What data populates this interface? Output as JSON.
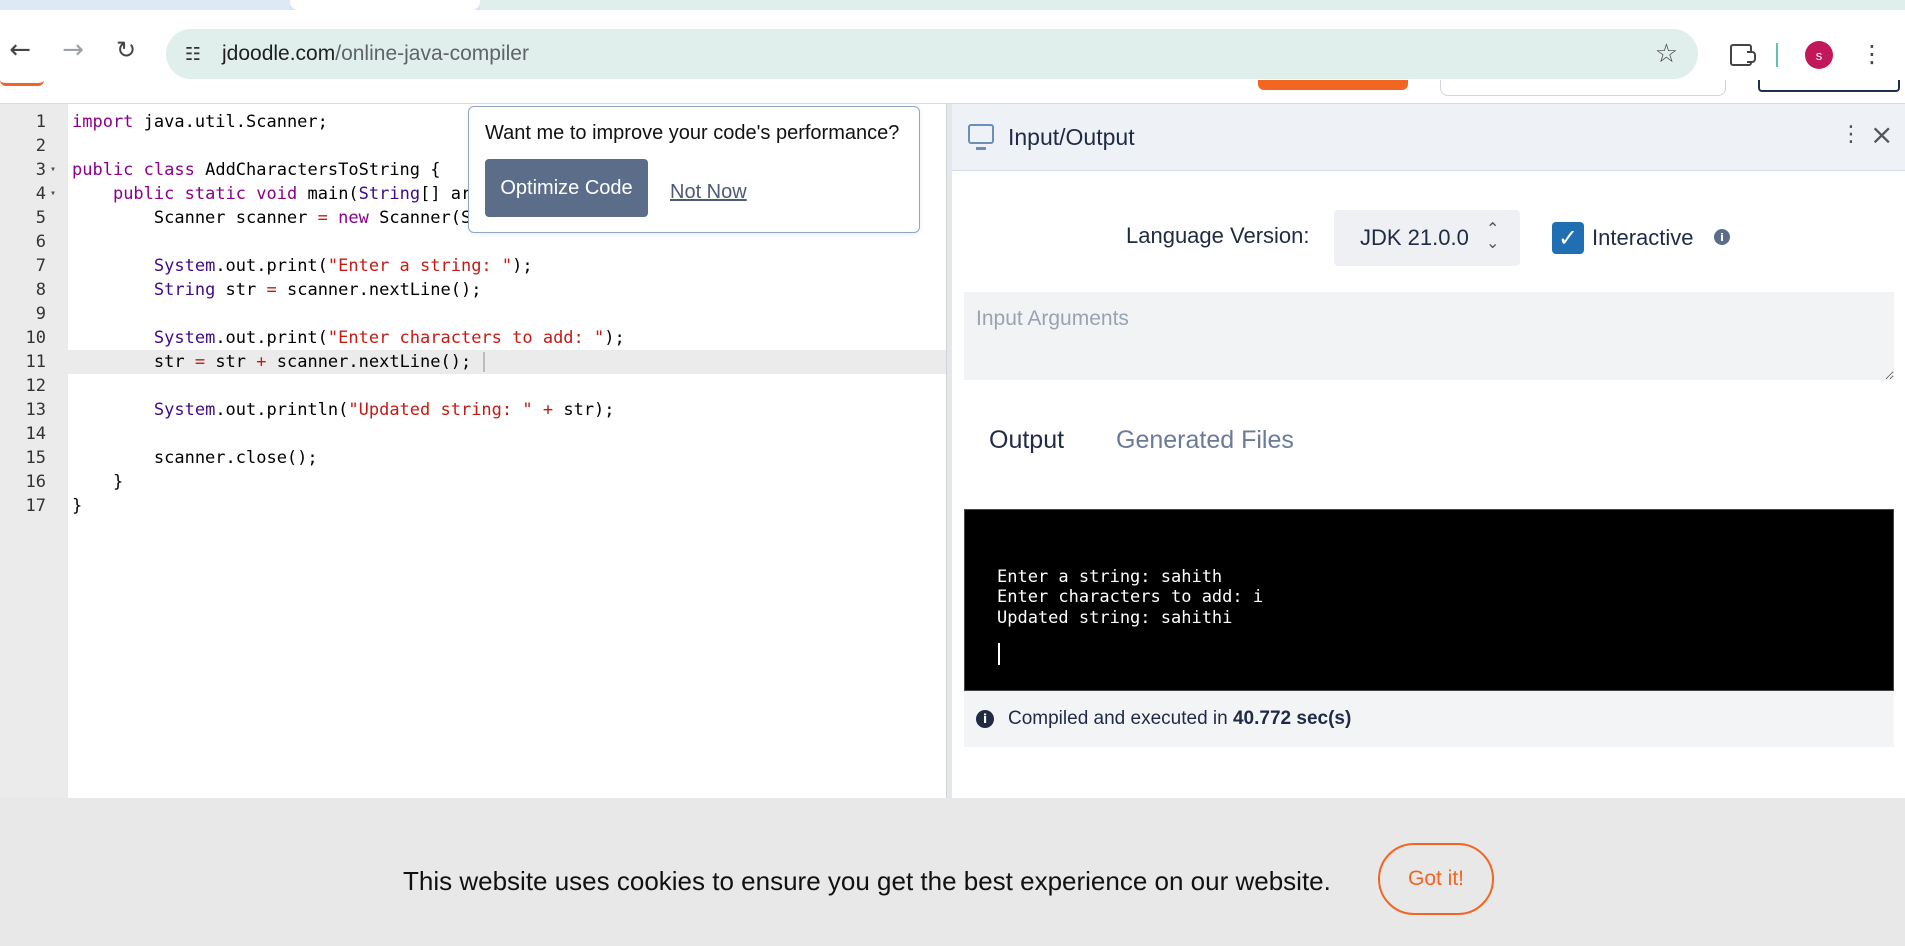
{
  "browser": {
    "url_host": "jdoodle.com",
    "url_path": "/online-java-compiler",
    "avatar_letter": "s",
    "icons": [
      "back-arrow-icon",
      "forward-arrow-icon",
      "reload-icon",
      "site-info-icon",
      "star-icon",
      "extensions-icon",
      "kebab-menu-icon"
    ]
  },
  "editor": {
    "lines": [
      {
        "n": "1",
        "fold": "",
        "html": "<span class=\"kw\">import</span> java.util.Scanner;"
      },
      {
        "n": "2",
        "fold": "",
        "html": ""
      },
      {
        "n": "3",
        "fold": "▾",
        "html": "<span class=\"kw\">public</span> <span class=\"kw\">class</span> AddCharactersToString {"
      },
      {
        "n": "4",
        "fold": "▾",
        "html": "    <span class=\"kw\">public</span> <span class=\"kw\">static</span> <span class=\"kw\">void</span> main(<span class=\"tp\">String</span>[] args) {"
      },
      {
        "n": "5",
        "fold": "",
        "html": "        Scanner scanner <span class=\"op\">=</span> <span class=\"kw\">new</span> Scanner(System.in);"
      },
      {
        "n": "6",
        "fold": "",
        "html": ""
      },
      {
        "n": "7",
        "fold": "",
        "html": "        <span class=\"tp\">System</span>.out.print(<span class=\"str\">\"Enter a string: \"</span>);"
      },
      {
        "n": "8",
        "fold": "",
        "html": "        <span class=\"tp\">String</span> str <span class=\"op\">=</span> scanner.nextLine();"
      },
      {
        "n": "9",
        "fold": "",
        "html": ""
      },
      {
        "n": "10",
        "fold": "",
        "html": "        <span class=\"tp\">System</span>.out.print(<span class=\"str\">\"Enter characters to add: \"</span>);"
      },
      {
        "n": "11",
        "fold": "",
        "html": "        str <span class=\"op\">=</span> str <span class=\"op\">+</span> scanner.nextLine();<span class=\"cursor-bar\"></span>",
        "active": true
      },
      {
        "n": "12",
        "fold": "",
        "html": ""
      },
      {
        "n": "13",
        "fold": "",
        "html": "        <span class=\"tp\">System</span>.out.println(<span class=\"str\">\"Updated string: \"</span> <span class=\"op\">+</span> str);"
      },
      {
        "n": "14",
        "fold": "",
        "html": ""
      },
      {
        "n": "15",
        "fold": "",
        "html": "        scanner.close();"
      },
      {
        "n": "16",
        "fold": "",
        "html": "    }"
      },
      {
        "n": "17",
        "fold": "",
        "html": "}"
      }
    ]
  },
  "popup": {
    "question": "Want me to improve your code's performance?",
    "optimize_label": "Optimize Code",
    "not_now_label": "Not Now"
  },
  "panel": {
    "title": "Input/Output",
    "language_label": "Language Version:",
    "language_value": "JDK 21.0.0",
    "interactive_label": "Interactive",
    "interactive_checked": true,
    "input_placeholder": "Input Arguments",
    "tabs": {
      "output": "Output",
      "files": "Generated Files"
    },
    "terminal_lines": [
      "Enter a string: sahith",
      "Enter characters to add: i",
      "Updated string: sahithi"
    ],
    "status_prefix": "Compiled and executed in ",
    "status_time": "40.772 sec(s)"
  },
  "cookie": {
    "message": "This website uses cookies to ensure you get the best experience on our website.",
    "button_label": "Got it!"
  },
  "colors": {
    "brand_orange": "#f26522",
    "checkbox_blue": "#1f6fb2",
    "optimize_button": "#5c6d8a"
  }
}
